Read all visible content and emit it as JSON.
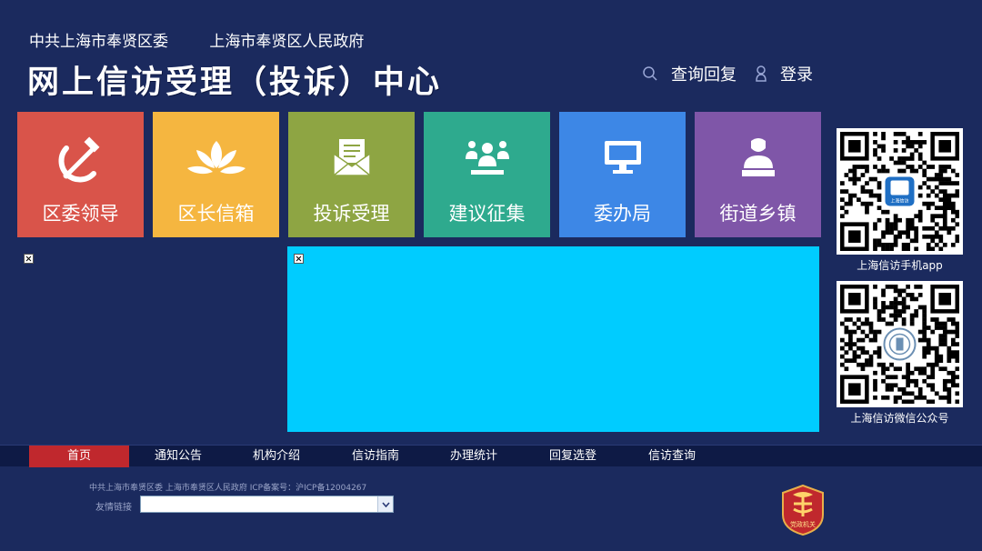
{
  "header": {
    "org_left": "中共上海市奉贤区委",
    "org_right": "上海市奉贤区人民政府",
    "title": "网上信访受理（投诉）中心",
    "query_label": "查询回复",
    "login_label": "登录"
  },
  "tiles": [
    {
      "label": "区委领导",
      "color": "#d9544a",
      "icon": "hammer-sickle-icon"
    },
    {
      "label": "区长信箱",
      "color": "#f5b640",
      "icon": "magnolia-flower-icon"
    },
    {
      "label": "投诉受理",
      "color": "#8ea543",
      "icon": "envelope-letter-icon"
    },
    {
      "label": "建议征集",
      "color": "#2eaa8e",
      "icon": "people-group-icon"
    },
    {
      "label": "委办局",
      "color": "#3d87e6",
      "icon": "monitor-icon"
    },
    {
      "label": "街道乡镇",
      "color": "#7f56a8",
      "icon": "person-desk-icon"
    }
  ],
  "qr": {
    "app_caption": "上海信访手机app",
    "app_logo_text": "上海信访",
    "wechat_caption": "上海信访微信公众号"
  },
  "nav": {
    "items": [
      "首页",
      "通知公告",
      "机构介绍",
      "信访指南",
      "办理统计",
      "回复选登",
      "信访查询"
    ],
    "active_color": "#c0282d"
  },
  "footer": {
    "copyright": "中共上海市奉贤区委 上海市奉贤区人民政府 ICP备案号：沪ICP备12004267",
    "friend_links_label": "友情链接",
    "friend_links_value": "",
    "badge_text": "党政机关"
  },
  "colors": {
    "background": "#1b2a5e",
    "banner": "#00ccff"
  }
}
